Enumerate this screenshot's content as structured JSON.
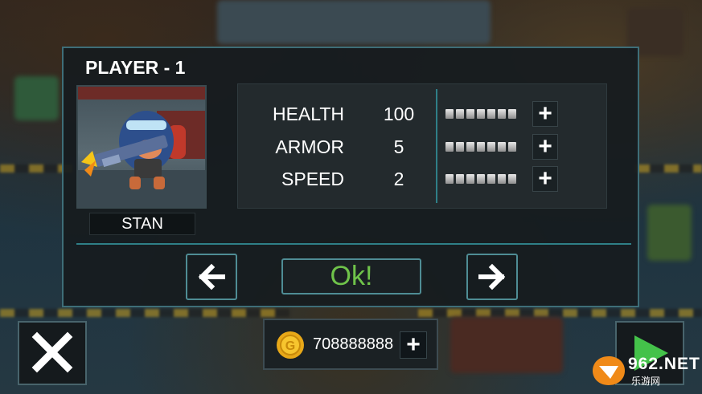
{
  "player": {
    "title": "PLAYER - 1",
    "name": "STAN"
  },
  "stats": [
    {
      "label": "HEALTH",
      "value": "100",
      "upgrade_level": 0,
      "upgrade_max": 7
    },
    {
      "label": "ARMOR",
      "value": "5",
      "upgrade_level": 0,
      "upgrade_max": 7
    },
    {
      "label": "SPEED",
      "value": "2",
      "upgrade_level": 0,
      "upgrade_max": 7
    }
  ],
  "buttons": {
    "ok_label": "Ok!",
    "plus_glyph": "+"
  },
  "currency": {
    "amount": "708888888",
    "icon": "gold-coin-icon"
  },
  "watermark": {
    "text": "962.NET",
    "subtext": "乐游网"
  },
  "colors": {
    "accent": "#4f8d95",
    "ok_text": "#6fc34a",
    "play": "#44c24a",
    "coin": "#e8a818"
  }
}
